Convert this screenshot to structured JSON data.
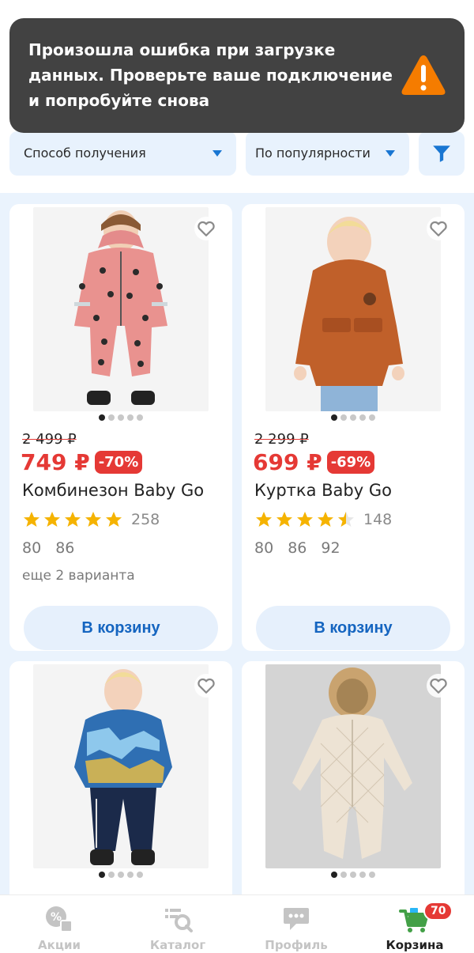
{
  "toast": {
    "message": "Произошла ошибка при загрузке данных. Проверьте ваше подключение и попробуйте снова",
    "icon": "warning-icon",
    "icon_color": "#f57c00"
  },
  "filters": {
    "delivery_label": "Способ получения",
    "sort_label": "По популярности",
    "filter_icon": "filter-icon"
  },
  "products": [
    {
      "old_price": "2 499 ₽",
      "price": "749 ₽",
      "discount": "-70%",
      "name": "Комбинезон Baby Go",
      "rating": 5,
      "rating_count": "258",
      "sizes": [
        "80",
        "86"
      ],
      "variants": "еще 2 варианта",
      "button": "В корзину"
    },
    {
      "old_price": "2 299 ₽",
      "price": "699 ₽",
      "discount": "-69%",
      "name": "Куртка Baby Go",
      "rating": 4.5,
      "rating_count": "148",
      "sizes": [
        "80",
        "86",
        "92"
      ],
      "button": "В корзину"
    }
  ],
  "nav": {
    "items": [
      {
        "label": "Акции",
        "icon": "promo-icon"
      },
      {
        "label": "Каталог",
        "icon": "catalog-search-icon"
      },
      {
        "label": "Профиль",
        "icon": "profile-icon"
      },
      {
        "label": "Корзина",
        "icon": "cart-icon"
      }
    ],
    "active": "Корзина",
    "cart_count": "70"
  },
  "colors": {
    "accent_blue": "#1976d2",
    "sale_red": "#e53935",
    "star_yellow": "#f5b301",
    "cart_green": "#43a047"
  }
}
